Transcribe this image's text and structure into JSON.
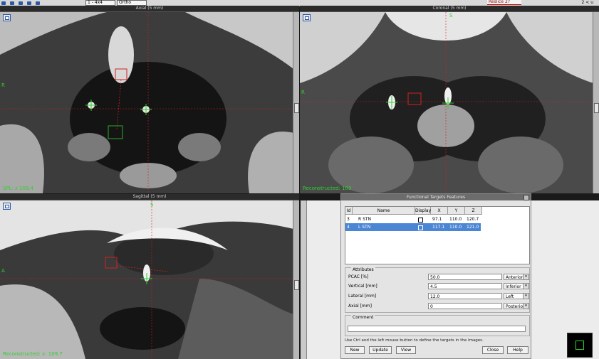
{
  "toolbar": {
    "view_select": "1 - 4x4",
    "layout_select": "Ortho",
    "status_text": "Reslice 2?",
    "zoom_text": "2 < u"
  },
  "panels": {
    "axial": {
      "title": "Axial (5 mm)",
      "readout": "SPL: z 109.4",
      "axis_label": "R"
    },
    "coronal": {
      "title": "Coronal (5 mm)",
      "readout": "Reconstructed: 109",
      "axis_label": "R",
      "top_label": "S"
    },
    "sagittal": {
      "title": "Sagittal (5 mm)",
      "readout": "Reconstructed: x: 109.7",
      "axis_label": "A",
      "top_label": "S"
    }
  },
  "dialog": {
    "title": "Functional Targets Features",
    "columns": [
      "Id",
      "Name",
      "Display",
      "X",
      "Y",
      "Z"
    ],
    "rows": [
      {
        "id": "3",
        "name": "R STN",
        "display": true,
        "x": "97.1",
        "y": "110.0",
        "z": "120.7"
      },
      {
        "id": "4",
        "name": "L STN",
        "display": true,
        "x": "117.1",
        "y": "110.0",
        "z": "121.0"
      }
    ],
    "attributes_legend": "Attributes",
    "attributes": [
      {
        "label": "PCAC [%]",
        "value": "50.0",
        "option": "Anterior"
      },
      {
        "label": "Vertical [mm]",
        "value": "4.5",
        "option": "Inferior"
      },
      {
        "label": "Lateral [mm]",
        "value": "12.0",
        "option": "Left"
      },
      {
        "label": "Axial [mm]",
        "value": "0",
        "option": "Posterior"
      }
    ],
    "comment_legend": "Comment",
    "comment_value": "",
    "hint": "Use Ctrl and the left mouse button to define the targets in the images.",
    "buttons": {
      "new": "New",
      "update": "Update",
      "view": "View",
      "close": "Close",
      "help": "Help"
    }
  },
  "colors": {
    "crosshair_red": "#d42020",
    "crosshair_green": "#2ed12e",
    "selection_blue": "#4b86d4"
  }
}
